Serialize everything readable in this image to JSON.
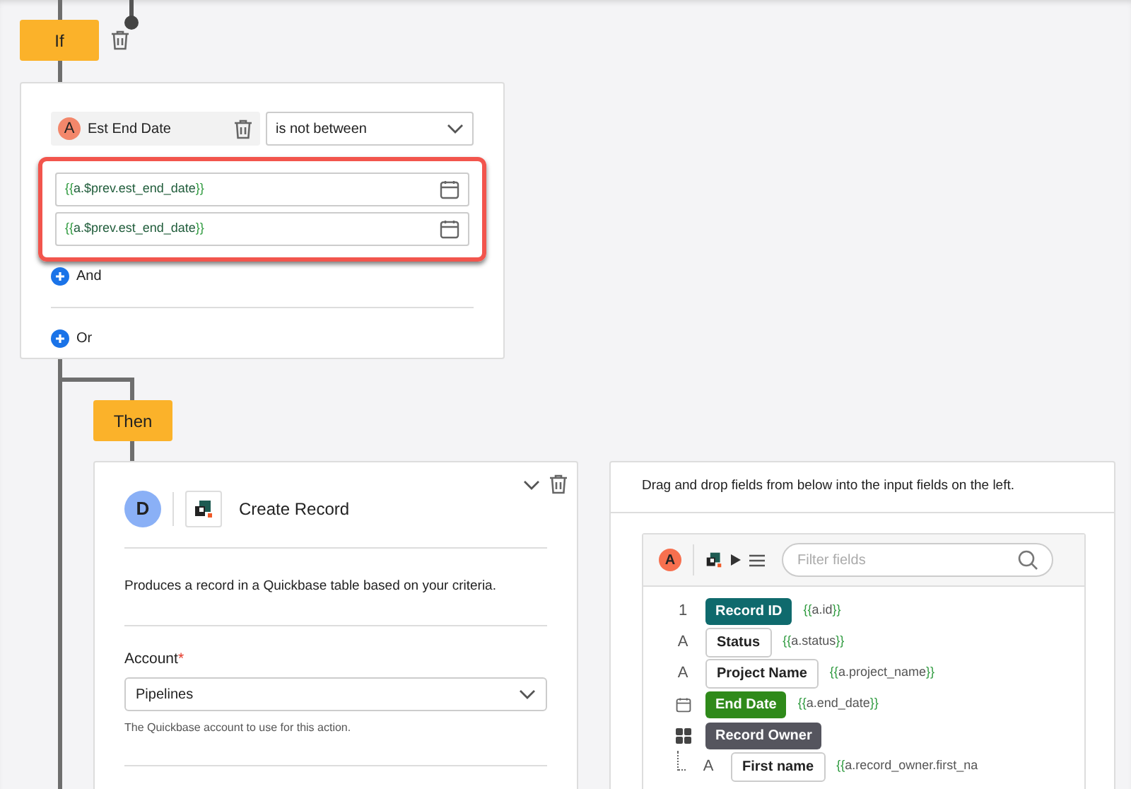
{
  "if_step": {
    "label": "If",
    "condition": {
      "badge": "A",
      "field": "Est End Date",
      "operator": "is not between",
      "highlighted": true,
      "values": [
        "{{a.$prev.est_end_date}}",
        "{{a.$prev.est_end_date}}"
      ]
    },
    "and": "And",
    "or": "Or"
  },
  "then_step": {
    "label": "Then",
    "action": {
      "badge": "D",
      "title": "Create Record",
      "description": "Produces a record in a Quickbase table based on your criteria.",
      "account": {
        "label": "Account",
        "required_mark": "*",
        "value": "Pipelines",
        "help": "The Quickbase account to use for this action."
      }
    }
  },
  "field_panel": {
    "instruction": "Drag and drop fields from below into the input fields on the left.",
    "source_badge": "A",
    "search": {
      "placeholder": "Filter fields"
    },
    "fields": [
      {
        "kind": "number",
        "type_label": "1",
        "name": "Record ID",
        "token": "{{a.id}}",
        "color": "#0f6a6d"
      },
      {
        "kind": "text",
        "type_label": "A",
        "name": "Status",
        "token": "{{a.status}}",
        "color": "#ffffff"
      },
      {
        "kind": "text",
        "type_label": "A",
        "name": "Project Name",
        "token": "{{a.project_name}}",
        "color": "#ffffff"
      },
      {
        "kind": "date",
        "name": "End Date",
        "token": "{{a.end_date}}",
        "color": "#2f8a1a"
      },
      {
        "kind": "user",
        "name": "Record Owner",
        "color": "#55555e",
        "children": [
          {
            "kind": "text",
            "type_label": "A",
            "name": "First name",
            "token": "{{a.record_owner.first_na",
            "color": "#ffffff"
          }
        ]
      }
    ]
  }
}
